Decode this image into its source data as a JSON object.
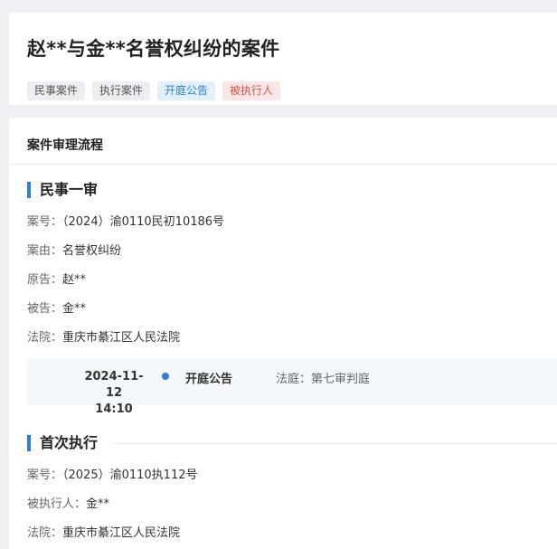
{
  "case": {
    "title": "赵**与金**名誉权纠纷的案件",
    "tags": [
      {
        "label": "民事案件",
        "color": "#eceef1"
      },
      {
        "label": "执行案件",
        "color": "#eceef1"
      },
      {
        "label": "开庭公告",
        "color": "#e3f0fb"
      },
      {
        "label": "被执行人",
        "color": "#fbe6e6"
      }
    ]
  },
  "process": {
    "header": "案件审理流程",
    "first_instance": {
      "title": "民事一审",
      "case_no_label": "案号：",
      "case_no": "（2024）渝0110民初10186号",
      "cause_label": "案由：",
      "cause": "名誉权纠纷",
      "plaintiff_label": "原告：",
      "plaintiff": "赵**",
      "defendant_label": "被告：",
      "defendant": "金**",
      "court_label": "法院：",
      "court": "重庆市綦江区人民法院",
      "timeline": {
        "date": "2024-11-12",
        "time": "14:10",
        "event": "开庭公告",
        "courtroom_label": "法庭：",
        "courtroom": "第七审判庭"
      }
    },
    "first_execution": {
      "title": "首次执行",
      "case_no_label": "案号：",
      "case_no": "（2025）渝0110执112号",
      "respondent_label": "被执行人：",
      "respondent": "金**",
      "court_label": "法院：",
      "court": "重庆市綦江区人民法院"
    }
  },
  "colors": {
    "accent": "#2f7fd6",
    "tag_blue_text": "#2b7fd0",
    "tag_red_text": "#d9534f"
  }
}
